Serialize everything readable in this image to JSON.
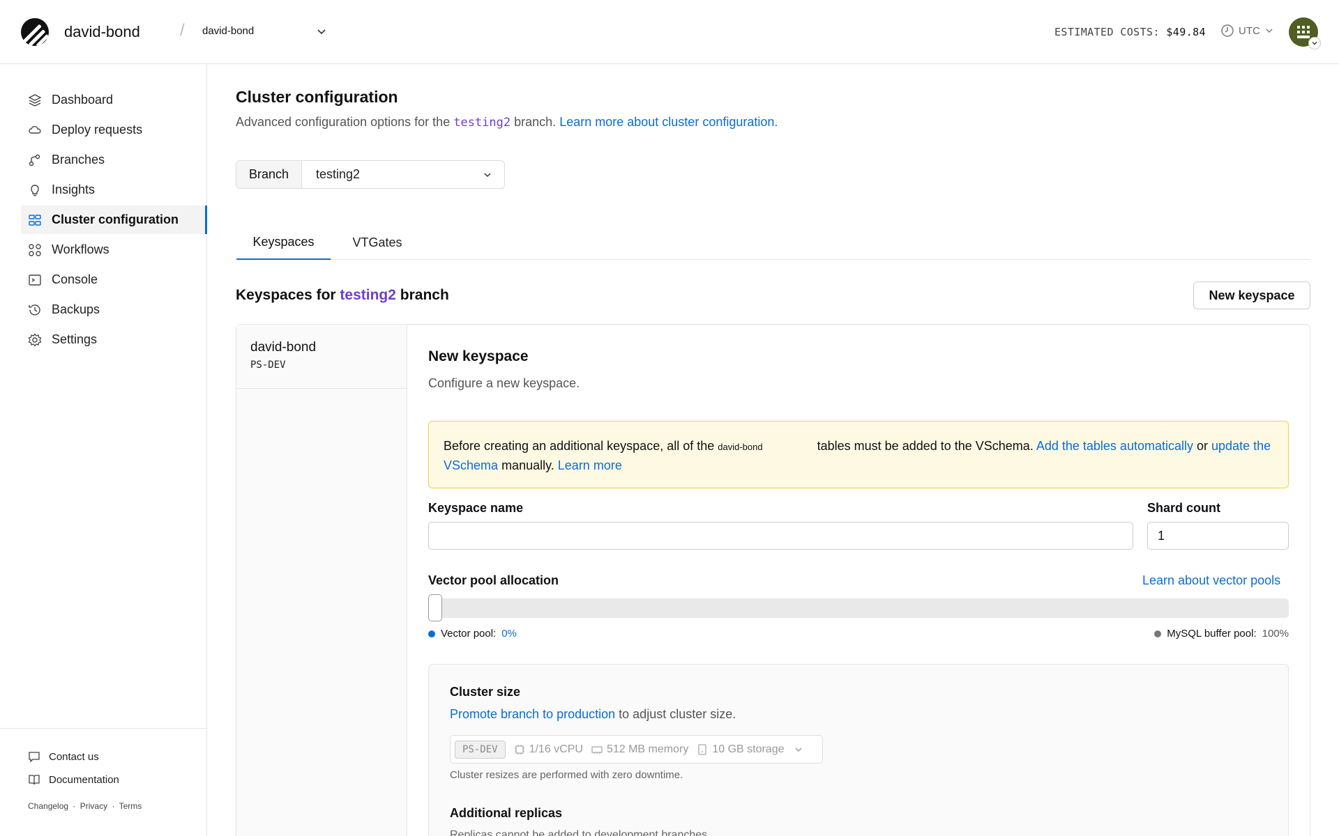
{
  "header": {
    "org_name": "david-bond",
    "database_name": "david-bond",
    "separator": "/",
    "estimated_costs_label": "ESTIMATED COSTS:",
    "estimated_costs_value": "$49.84",
    "timezone": "UTC"
  },
  "sidebar": {
    "items": [
      {
        "label": "Dashboard",
        "icon": "layers-icon"
      },
      {
        "label": "Deploy requests",
        "icon": "deploy-icon"
      },
      {
        "label": "Branches",
        "icon": "branch-icon"
      },
      {
        "label": "Insights",
        "icon": "lightbulb-icon"
      },
      {
        "label": "Cluster configuration",
        "icon": "cluster-icon",
        "active": true
      },
      {
        "label": "Workflows",
        "icon": "workflows-icon"
      },
      {
        "label": "Console",
        "icon": "console-icon"
      },
      {
        "label": "Backups",
        "icon": "backup-icon"
      },
      {
        "label": "Settings",
        "icon": "gear-icon"
      }
    ],
    "footer": {
      "contact": "Contact us",
      "documentation": "Documentation",
      "links": [
        "Changelog",
        "Privacy",
        "Terms"
      ],
      "link_separator": "·"
    }
  },
  "main": {
    "title": "Cluster configuration",
    "desc_prefix": "Advanced configuration options for the",
    "desc_branch": "testing2",
    "desc_suffix": "branch.",
    "desc_link": "Learn more about cluster configuration.",
    "branch_label": "Branch",
    "branch_value": "testing2",
    "tabs": [
      {
        "label": "Keyspaces",
        "active": true
      },
      {
        "label": "VTGates",
        "active": false
      }
    ],
    "keyspaces_heading_prefix": "Keyspaces for",
    "keyspaces_heading_branch": "testing2",
    "keyspaces_heading_suffix": "branch",
    "new_keyspace_button": "New keyspace",
    "keyspace_list": [
      {
        "name": "david-bond",
        "size": "PS-DEV"
      }
    ]
  },
  "form": {
    "title": "New keyspace",
    "desc": "Configure a new keyspace.",
    "alert": {
      "text1": "Before creating an additional keyspace, all of the",
      "db_name": "david-bond",
      "text2": "tables must be added to the VSchema.",
      "link1": "Add the tables automatically",
      "text3": "or",
      "link2": "update the VSchema",
      "text4": "manually.",
      "link3": "Learn more"
    },
    "keyspace_name_label": "Keyspace name",
    "keyspace_name_value": "",
    "shard_count_label": "Shard count",
    "shard_count_value": "1",
    "vector_pool_label": "Vector pool allocation",
    "vector_pool_link": "Learn about vector pools",
    "vector_pool_percent": 0,
    "legend_vector_label": "Vector pool:",
    "legend_vector_value": "0%",
    "legend_mysql_label": "MySQL buffer pool:",
    "legend_mysql_value": "100%",
    "colors": {
      "vector": "#0b6cd6",
      "mysql": "#777777",
      "alert_bg": "#fdf9e3",
      "alert_border": "#ebd24a",
      "accent": "#0b6cd6",
      "branch_highlight": "#6b3fd1"
    }
  },
  "cluster_size": {
    "title": "Cluster size",
    "link": "Promote branch to production",
    "desc_suffix": "to adjust cluster size.",
    "tag": "PS-DEV",
    "cpu": "1/16 vCPU",
    "memory": "512 MB memory",
    "storage": "10 GB storage",
    "note": "Cluster resizes are performed with zero downtime.",
    "replicas_title": "Additional replicas",
    "replicas_desc": "Replicas cannot be added to development branches."
  }
}
